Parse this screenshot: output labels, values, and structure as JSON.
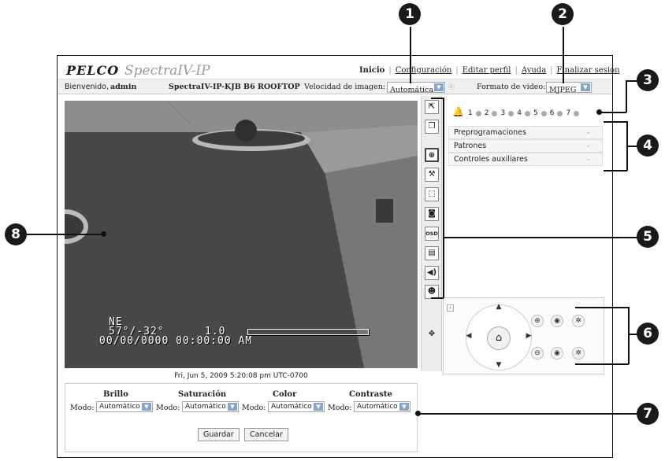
{
  "header": {
    "logo": "PELCO",
    "product": "SpectraIV-IP",
    "nav": [
      "Inicio",
      "Configuración",
      "Editar perfil",
      "Ayuda",
      "Finalizar sesión"
    ]
  },
  "infobar": {
    "welcome": "Bienvenido,",
    "user": "admin",
    "camera_name": "SpectraIV-IP-KJB B6 ROOFTOP",
    "frame_rate_label": "Velocidad de imagen:",
    "frame_rate_value": "Automática",
    "video_format_label": "Formato de video:",
    "video_format_value": "MJPEG"
  },
  "video": {
    "osd_direction": "NE",
    "osd_angles": "57°/-32°",
    "osd_zoom": "1.0",
    "osd_datetime": "00/00/0000 00:00:00 AM"
  },
  "timestamp": "Fri, Jun 5, 2009 5:20:08 pm UTC-0700",
  "toolbar": {
    "icons": [
      "popout-icon",
      "window-icon",
      "zoom-area-icon",
      "tools-icon",
      "select-area-icon",
      "snapshot-icon",
      "osd-icon",
      "histogram-icon",
      "audio-icon",
      "user-icon",
      "ptz-joystick-icon"
    ],
    "osd_label": "OSD"
  },
  "alarms": {
    "numbers": [
      "1",
      "2",
      "3",
      "4",
      "5",
      "6",
      "7"
    ]
  },
  "accordion": [
    "Preprogramaciones",
    "Patrones",
    "Controles auxiliares"
  ],
  "settings": {
    "columns": [
      {
        "title": "Brillo",
        "mode_label": "Modo:",
        "value": "Automático"
      },
      {
        "title": "Saturación",
        "mode_label": "Modo:",
        "value": "Automático"
      },
      {
        "title": "Color",
        "mode_label": "Modo:",
        "value": "Automático"
      },
      {
        "title": "Contraste",
        "mode_label": "Modo:",
        "value": "Automático"
      }
    ],
    "save": "Guardar",
    "cancel": "Cancelar"
  },
  "callouts": [
    "1",
    "2",
    "3",
    "4",
    "5",
    "6",
    "7",
    "8"
  ]
}
